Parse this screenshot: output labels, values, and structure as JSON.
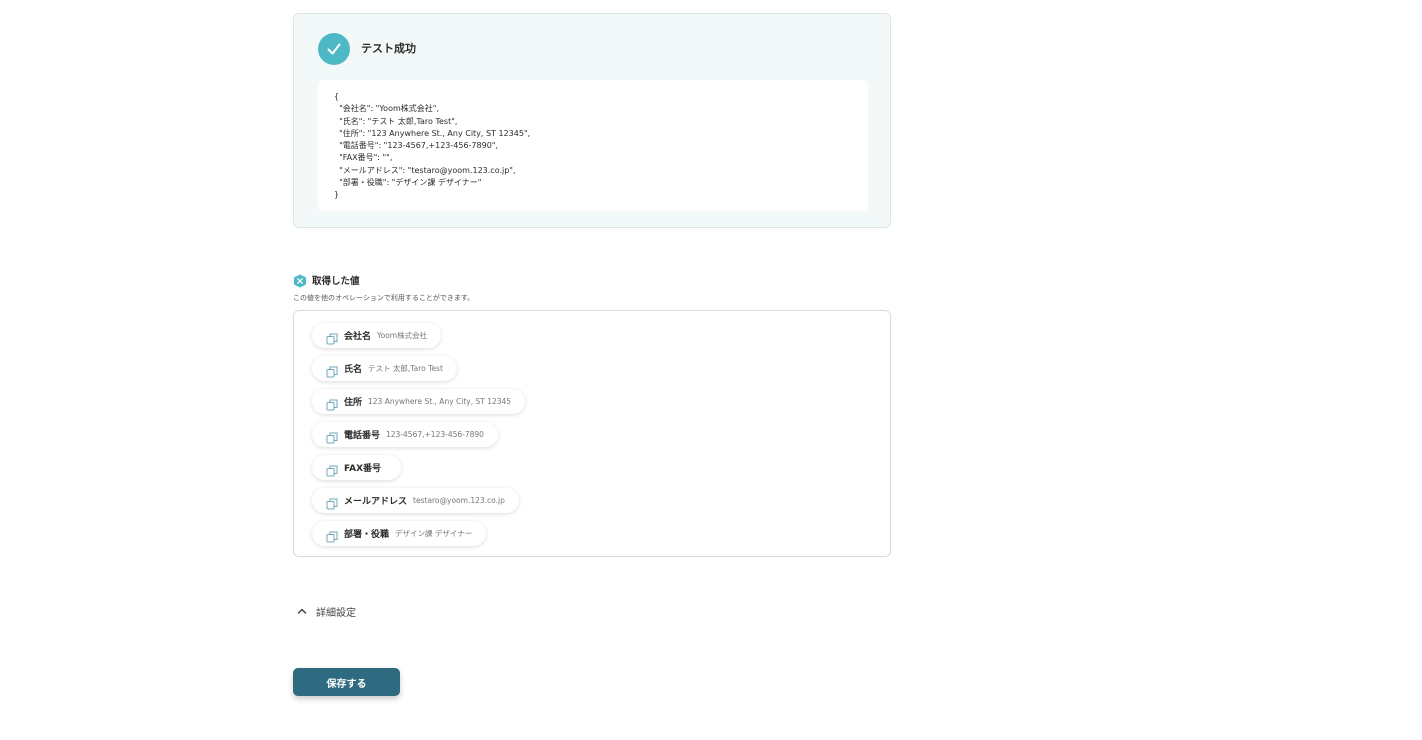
{
  "test_result": {
    "status": "テスト成功",
    "json_lines": [
      "{",
      "  \"会社名\": \"Yoom株式会社\",",
      "  \"氏名\": \"テスト 太郎,Taro Test\",",
      "  \"住所\": \"123 Anywhere St., Any City, ST 12345\",",
      "  \"電話番号\": \"123-4567,+123-456-7890\",",
      "  \"FAX番号\": \"\",",
      "  \"メールアドレス\": \"testaro@yoom.123.co.jp\",",
      "  \"部署・役職\": \"デザイン課 デザイナー\"",
      "}"
    ]
  },
  "acquired_values": {
    "title": "取得した値",
    "description": "この値を他のオペレーションで利用することができます。",
    "items": [
      {
        "key": "会社名",
        "value": "Yoom株式会社"
      },
      {
        "key": "氏名",
        "value": "テスト 太郎,Taro Test"
      },
      {
        "key": "住所",
        "value": "123 Anywhere St., Any City, ST 12345"
      },
      {
        "key": "電話番号",
        "value": "123-4567,+123-456-7890"
      },
      {
        "key": "FAX番号",
        "value": ""
      },
      {
        "key": "メールアドレス",
        "value": "testaro@yoom.123.co.jp"
      },
      {
        "key": "部署・役職",
        "value": "デザイン課 デザイナー"
      }
    ]
  },
  "advanced_settings": {
    "label": "詳細設定"
  },
  "save_button": {
    "label": "保存する"
  },
  "colors": {
    "accent": "#4db9c7",
    "primary_button": "#2e6a80",
    "card_background": "#f3f9f9"
  },
  "icons": {
    "status": "check-icon",
    "values_header": "x-badge-icon",
    "chip": "copy-icon",
    "advanced_toggle": "chevron-up-icon"
  }
}
